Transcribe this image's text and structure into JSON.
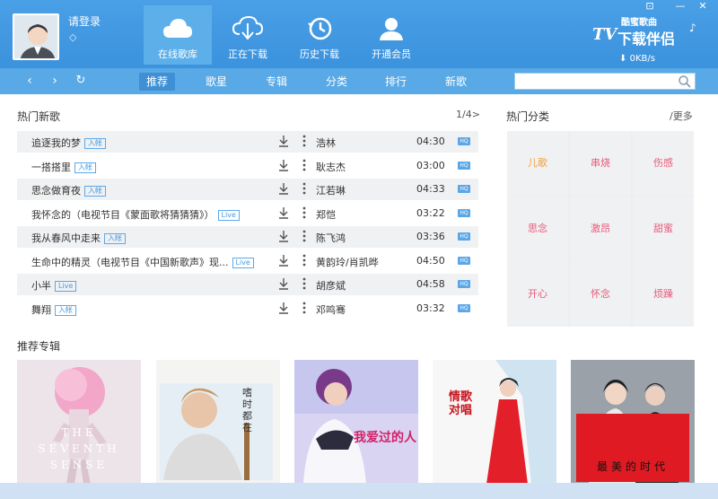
{
  "header": {
    "login_text": "请登录",
    "speed": "0KB/s",
    "nav": [
      {
        "label": "在线歌库",
        "icon": "cloud-icon",
        "active": true
      },
      {
        "label": "正在下载",
        "icon": "cloud-download-icon",
        "active": false
      },
      {
        "label": "历史下载",
        "icon": "history-icon",
        "active": false
      },
      {
        "label": "开通会员",
        "icon": "vip-user-icon",
        "active": false
      }
    ],
    "brand_line1": "酷蜜歌曲",
    "brand_line2": "下载伴侣"
  },
  "toolbar": {
    "tabs": [
      {
        "label": "推荐",
        "active": true
      },
      {
        "label": "歌星",
        "active": false
      },
      {
        "label": "专辑",
        "active": false
      },
      {
        "label": "分类",
        "active": false
      },
      {
        "label": "排行",
        "active": false
      },
      {
        "label": "新歌",
        "active": false
      }
    ],
    "search_placeholder": ""
  },
  "songs": {
    "title": "热门新歌",
    "page": "1/4>",
    "rows": [
      {
        "name": "追逐我的梦",
        "tag": "入帐",
        "artist": "浩林",
        "duration": "04:30"
      },
      {
        "name": "一搭搭里",
        "tag": "入帐",
        "artist": "耿志杰",
        "duration": "03:00"
      },
      {
        "name": "思念做育夜",
        "tag": "入帐",
        "artist": "江若琳",
        "duration": "04:33"
      },
      {
        "name": "我怀念的（电视节目《蒙面歌将猜猜猜》）",
        "tag": "Live",
        "artist": "郑恺",
        "duration": "03:22"
      },
      {
        "name": "我从春风中走来",
        "tag": "入帐",
        "artist": "陈飞鸿",
        "duration": "03:36"
      },
      {
        "name": "生命中的精灵（电视节目《中国新歌声》现...",
        "tag": "Live",
        "artist": "黄韵玲/肖凯晔",
        "duration": "04:50"
      },
      {
        "name": "小半",
        "tag": "Live",
        "artist": "胡彦斌",
        "duration": "04:58"
      },
      {
        "name": "舞翔",
        "tag": "入帐",
        "artist": "邓鸣骞",
        "duration": "03:32"
      }
    ]
  },
  "categories": {
    "title": "热门分类",
    "more": "/更多",
    "items": [
      {
        "label": "儿歌",
        "color": "#f0a040"
      },
      {
        "label": "串烧",
        "color": "#e85a7a"
      },
      {
        "label": "伤感",
        "color": "#e85a7a"
      },
      {
        "label": "思念",
        "color": "#e85a7a"
      },
      {
        "label": "激昂",
        "color": "#e85a7a"
      },
      {
        "label": "甜蜜",
        "color": "#e85a7a"
      },
      {
        "label": "开心",
        "color": "#e85a7a"
      },
      {
        "label": "怀念",
        "color": "#e85a7a"
      },
      {
        "label": "烦躁",
        "color": "#e85a7a"
      }
    ]
  },
  "albums": {
    "title": "推荐专辑",
    "covers": [
      {
        "text": "THE SEVENTH SENSE",
        "bg": "#e9e2e6"
      },
      {
        "text": "嗜时都在",
        "bg": "#f4f4f2"
      },
      {
        "text": "我爱过的人",
        "bg": "#d9d6f2"
      },
      {
        "text": "情歌对唱",
        "bg": "#f7f7f7"
      },
      {
        "text": "最美的时代",
        "bg": "#9aa0a8"
      }
    ]
  },
  "colors": {
    "accent": "#3b92dd",
    "toolbar": "#58a9e6",
    "tag": "#4a9be0"
  }
}
